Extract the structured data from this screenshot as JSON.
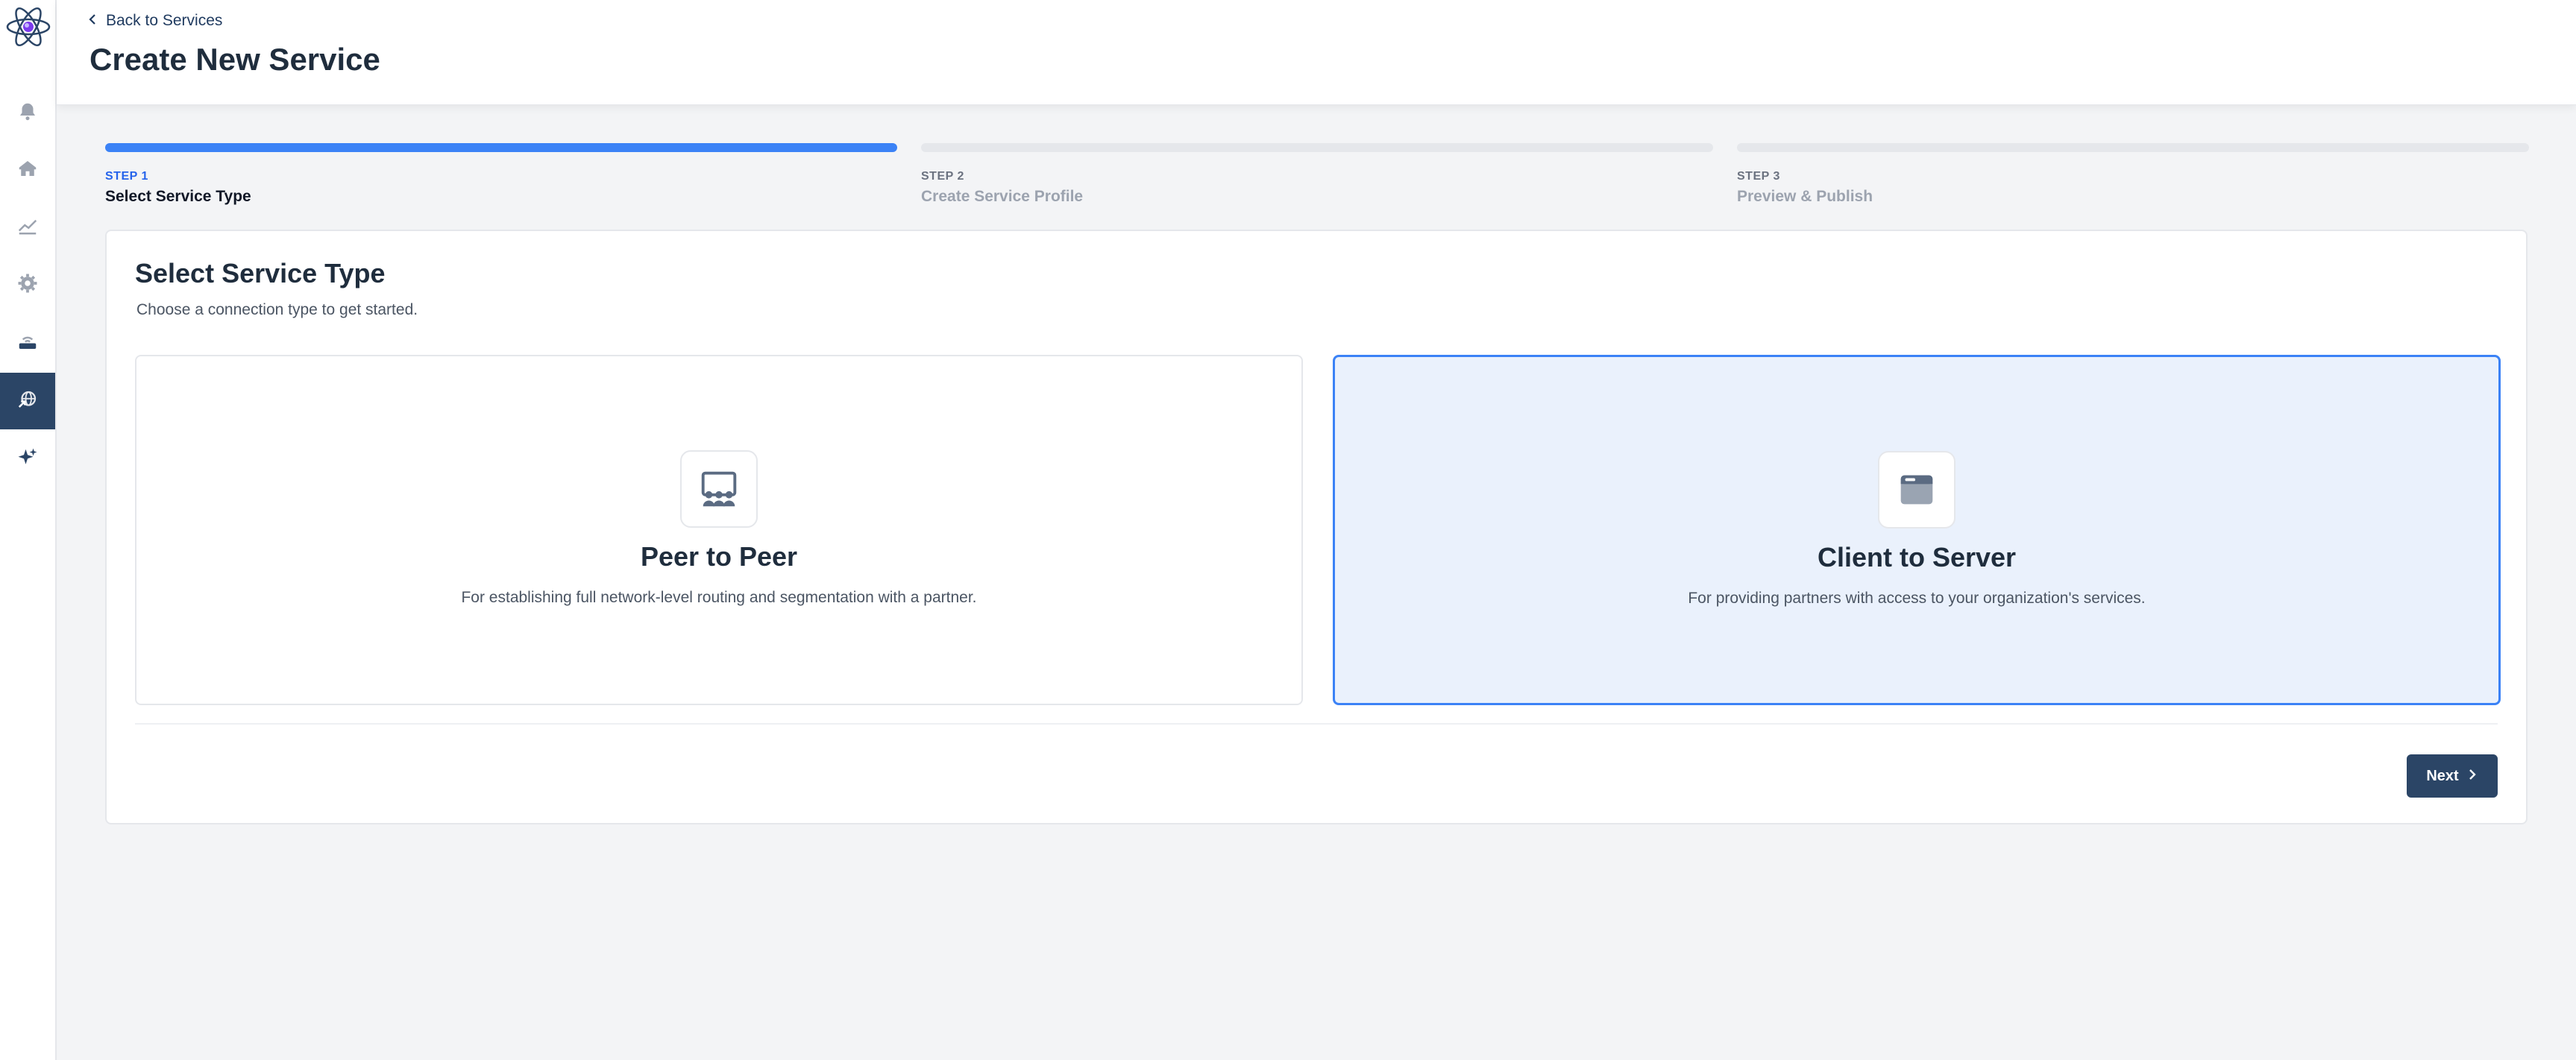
{
  "sidebar": {
    "logo_icon": "atom-logo-icon",
    "items": [
      {
        "name": "bell-icon",
        "active": false
      },
      {
        "name": "home-icon",
        "active": false
      },
      {
        "name": "chart-icon",
        "active": false
      },
      {
        "name": "gear-icon",
        "active": false
      },
      {
        "name": "router-icon",
        "active": false
      },
      {
        "name": "services-globe-icon",
        "active": true
      },
      {
        "name": "sparkles-icon",
        "active": false
      }
    ]
  },
  "header": {
    "back_label": "Back to Services",
    "title": "Create New Service"
  },
  "stepper": {
    "steps": [
      {
        "number": "STEP 1",
        "label": "Select Service Type",
        "active": true
      },
      {
        "number": "STEP 2",
        "label": "Create Service Profile",
        "active": false
      },
      {
        "number": "STEP 3",
        "label": "Preview & Publish",
        "active": false
      }
    ]
  },
  "card": {
    "title": "Select Service Type",
    "subtitle": "Choose a connection type to get started.",
    "options": [
      {
        "icon": "peer-group-icon",
        "title": "Peer to Peer",
        "description": "For establishing full network-level routing and segmentation with a partner.",
        "selected": false
      },
      {
        "icon": "browser-window-icon",
        "title": "Client to Server",
        "description": "For providing partners with access to your organization's services.",
        "selected": true
      }
    ],
    "next_label": "Next"
  },
  "colors": {
    "accent": "#3b82f6",
    "primary_dark": "#2b4566",
    "selected_bg": "#eaf1fc",
    "background": "#f3f4f6"
  }
}
